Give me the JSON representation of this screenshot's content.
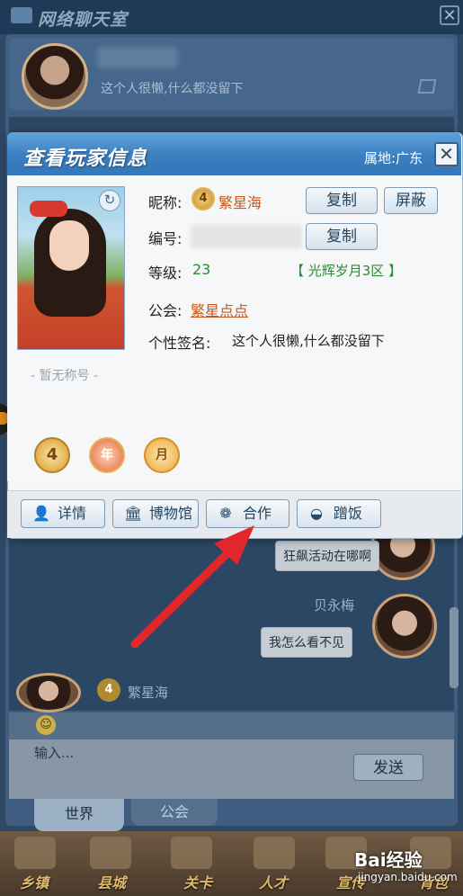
{
  "background": {
    "window_title": "网络聊天室",
    "close_glyph": "✕",
    "profile_signature": "这个人很懒,什么都没留下",
    "messages": [
      {
        "text": "狂飙活动在哪啊"
      },
      {
        "sender": "贝永梅",
        "text": "我怎么看不见"
      }
    ],
    "left_sender_badge": "4",
    "left_sender_name": "繁星海",
    "input_placeholder": "输入...",
    "send_label": "发送",
    "tabs": [
      {
        "label": "世界"
      },
      {
        "label": "公会"
      }
    ],
    "bottom_nav": [
      {
        "label": "乡镇"
      },
      {
        "label": "县城"
      },
      {
        "label": "关卡"
      },
      {
        "label": "人才"
      },
      {
        "label": "宣传"
      },
      {
        "label": "背包"
      }
    ],
    "watermark_logo": "Bai经验",
    "watermark_url": "jingyan.baidu.com"
  },
  "dialog": {
    "title": "查看玩家信息",
    "location": "属地:广东",
    "close_glyph": "✕",
    "portrait_refresh_glyph": "↻",
    "no_title": "- 暂无称号 -",
    "fields": {
      "nickname_label": "昵称:",
      "nickname_badge": "4",
      "nickname": "繁星海",
      "id_label": "编号:",
      "level_label": "等级:",
      "level": "23",
      "server": "【 光辉岁月3区 】",
      "guild_label": "公会:",
      "guild": "繁星点点",
      "signature_label": "个性签名:",
      "signature": "这个人很懒,什么都没留下"
    },
    "buttons": {
      "copy_nickname": "复制",
      "block": "屏蔽",
      "copy_id": "复制"
    },
    "medals": [
      {
        "text": "4",
        "icon": "level-medal-icon"
      },
      {
        "text": "年",
        "icon": "year-medal-icon"
      },
      {
        "text": "月",
        "icon": "month-medal-icon"
      }
    ],
    "actions": [
      {
        "label": "详情",
        "icon": "person-icon",
        "glyph": "👤"
      },
      {
        "label": "博物馆",
        "icon": "museum-icon",
        "glyph": "🏛"
      },
      {
        "label": "合作",
        "icon": "film-reel-icon",
        "glyph": "❁"
      },
      {
        "label": "蹭饭",
        "icon": "bowl-icon",
        "glyph": "◒"
      }
    ]
  },
  "colors": {
    "header_blue": "#3c7fc0",
    "accent_orange": "#c5591a",
    "accent_green": "#2f8a35",
    "arrow_red": "#e3262a"
  }
}
